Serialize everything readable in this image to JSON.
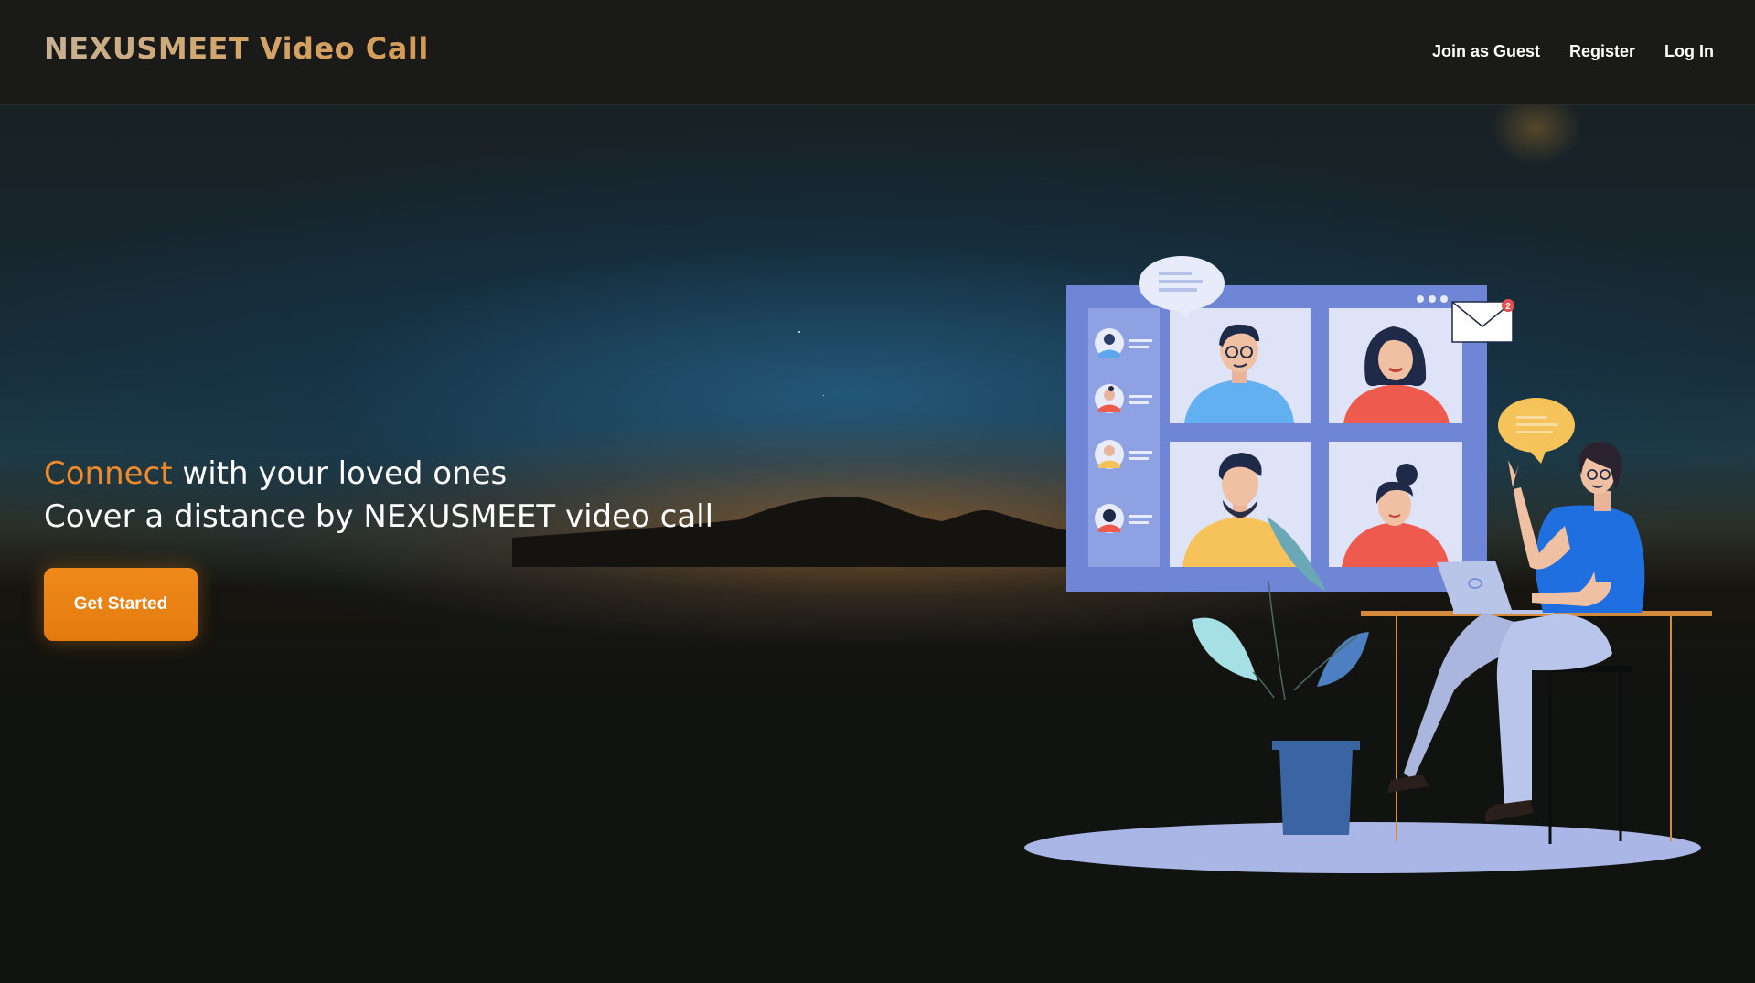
{
  "header": {
    "brand": "NEXUSMEET Video Call",
    "nav": [
      {
        "label": "Join as Guest"
      },
      {
        "label": "Register"
      },
      {
        "label": "Log In"
      }
    ]
  },
  "hero": {
    "line1_accent": "Connect",
    "line1_rest": " with your loved ones",
    "line2": "Cover a distance by NEXUSMEET video call",
    "cta_label": "Get Started"
  },
  "illustration": {
    "notification_count": "2",
    "colors": {
      "accent": "#f08a2a",
      "screen_blue": "#6f86d6",
      "tile_bg": "#dfe3f7",
      "shirt_blue": "#1f6fe0"
    }
  }
}
